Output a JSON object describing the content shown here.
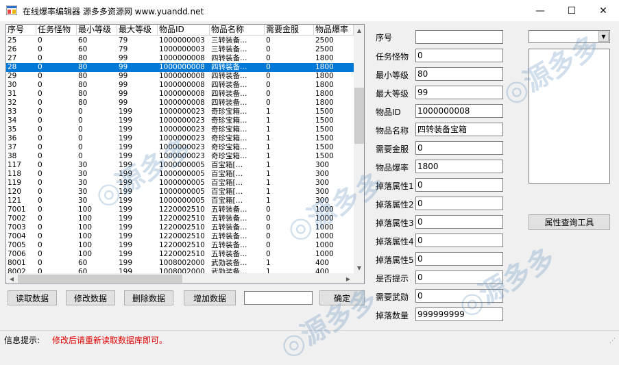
{
  "window": {
    "title": "在线爆率编辑器 源多多资源网 www.yuandd.net",
    "minimize_glyph": "—",
    "maximize_glyph": "☐",
    "close_glyph": "✕"
  },
  "grid": {
    "columns": [
      "序号",
      "任务怪物",
      "最小等级",
      "最大等级",
      "物品ID",
      "物品名称",
      "需要金服",
      "物品爆率"
    ],
    "selected_index": 3,
    "rows": [
      [
        "25",
        "0",
        "60",
        "79",
        "1000000003",
        "三转装备…",
        "0",
        "2500"
      ],
      [
        "26",
        "0",
        "60",
        "79",
        "1000000003",
        "三转装备…",
        "0",
        "2500"
      ],
      [
        "27",
        "0",
        "80",
        "99",
        "1000000008",
        "四转装备…",
        "0",
        "1800"
      ],
      [
        "28",
        "0",
        "80",
        "99",
        "1000000008",
        "四转装备…",
        "0",
        "1800"
      ],
      [
        "29",
        "0",
        "80",
        "99",
        "1000000008",
        "四转装备…",
        "0",
        "1800"
      ],
      [
        "30",
        "0",
        "80",
        "99",
        "1000000008",
        "四转装备…",
        "0",
        "1800"
      ],
      [
        "31",
        "0",
        "80",
        "99",
        "1000000008",
        "四转装备…",
        "0",
        "1800"
      ],
      [
        "32",
        "0",
        "80",
        "99",
        "1000000008",
        "四转装备…",
        "0",
        "1800"
      ],
      [
        "33",
        "0",
        "0",
        "199",
        "1000000023",
        "奇珍宝箱…",
        "1",
        "1500"
      ],
      [
        "34",
        "0",
        "0",
        "199",
        "1000000023",
        "奇珍宝箱…",
        "1",
        "1500"
      ],
      [
        "35",
        "0",
        "0",
        "199",
        "1000000023",
        "奇珍宝箱…",
        "1",
        "1500"
      ],
      [
        "36",
        "0",
        "0",
        "199",
        "1000000023",
        "奇珍宝箱…",
        "1",
        "1500"
      ],
      [
        "37",
        "0",
        "0",
        "199",
        "1000000023",
        "奇珍宝箱…",
        "1",
        "1500"
      ],
      [
        "38",
        "0",
        "0",
        "199",
        "1000000023",
        "奇珍宝箱…",
        "1",
        "1500"
      ],
      [
        "117",
        "0",
        "30",
        "199",
        "1000000005",
        "百宝箱[…",
        "1",
        "300"
      ],
      [
        "118",
        "0",
        "30",
        "199",
        "1000000005",
        "百宝箱[…",
        "1",
        "300"
      ],
      [
        "119",
        "0",
        "30",
        "199",
        "1000000005",
        "百宝箱[…",
        "1",
        "300"
      ],
      [
        "120",
        "0",
        "30",
        "199",
        "1000000005",
        "百宝箱[…",
        "1",
        "300"
      ],
      [
        "121",
        "0",
        "30",
        "199",
        "1000000005",
        "百宝箱[…",
        "1",
        "300"
      ],
      [
        "7001",
        "0",
        "100",
        "199",
        "1220002510",
        "五转装备…",
        "0",
        "1000"
      ],
      [
        "7002",
        "0",
        "100",
        "199",
        "1220002510",
        "五转装备…",
        "0",
        "1000"
      ],
      [
        "7003",
        "0",
        "100",
        "199",
        "1220002510",
        "五转装备…",
        "0",
        "1000"
      ],
      [
        "7004",
        "0",
        "100",
        "199",
        "1220002510",
        "五转装备…",
        "0",
        "1000"
      ],
      [
        "7005",
        "0",
        "100",
        "199",
        "1220002510",
        "五转装备…",
        "0",
        "1000"
      ],
      [
        "7006",
        "0",
        "100",
        "199",
        "1220002510",
        "五转装备…",
        "0",
        "1000"
      ],
      [
        "8001",
        "0",
        "60",
        "199",
        "1008002000",
        "武勋装备…",
        "1",
        "400"
      ],
      [
        "8002",
        "0",
        "60",
        "199",
        "1008002000",
        "武勋装备…",
        "1",
        "400"
      ]
    ]
  },
  "buttons": {
    "read": "读取数据",
    "modify": "修改数据",
    "delete": "删除数据",
    "add": "增加数据",
    "confirm": "确定",
    "attr_query": "属性查询工具"
  },
  "search_input": "",
  "form": {
    "labels": {
      "index": "序号",
      "monster": "任务怪物",
      "min_level": "最小等级",
      "max_level": "最大等级",
      "item_id": "物品ID",
      "item_name": "物品名称",
      "need_gold": "需要金服",
      "drop_rate": "物品爆率",
      "attr1": "掉落属性1",
      "attr2": "掉落属性2",
      "attr3": "掉落属性3",
      "attr4": "掉落属性4",
      "attr5": "掉落属性5",
      "notify": "是否提示",
      "need_medal": "需要武勋",
      "drop_count": "掉落数量"
    },
    "values": {
      "index": "",
      "monster": "0",
      "min_level": "80",
      "max_level": "99",
      "item_id": "1000000008",
      "item_name": "四转装备宝箱",
      "need_gold": "0",
      "drop_rate": "1800",
      "attr1": "0",
      "attr2": "0",
      "attr3": "0",
      "attr4": "0",
      "attr5": "0",
      "notify": "0",
      "need_medal": "0",
      "drop_count": "999999999"
    }
  },
  "attr_combo_value": "",
  "status": {
    "label": "信息提示:",
    "message": "修改后请重新读取数据库即可。",
    "message_color": "#e00000"
  },
  "colors": {
    "selection": "#0078d7"
  }
}
